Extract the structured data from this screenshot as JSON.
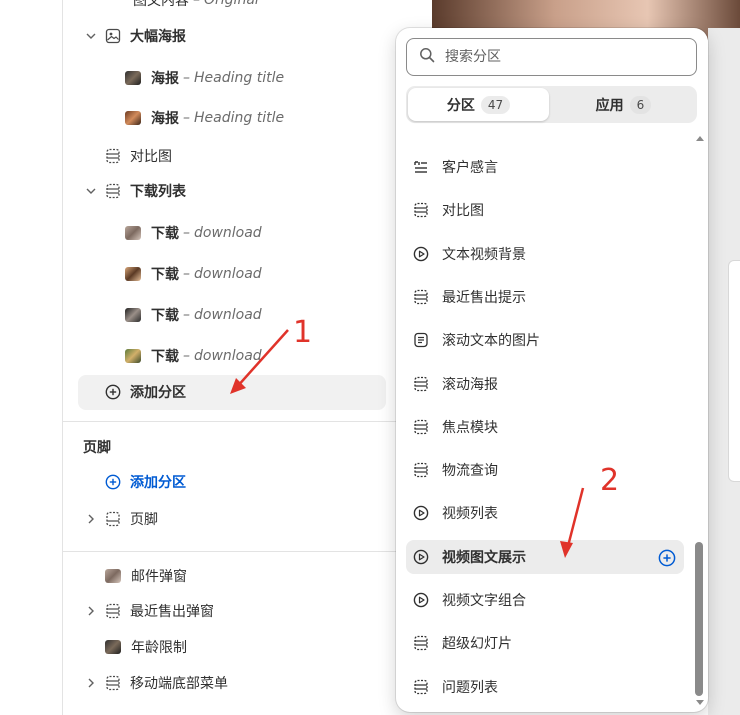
{
  "left_tree": {
    "top_cut_item": {
      "name": "图文内容",
      "subtitle": "Original"
    },
    "items": [
      {
        "label": "大幅海报",
        "icon": "image-section-icon",
        "expandable": true
      },
      {
        "label": "海报",
        "subtitle": "Heading title"
      },
      {
        "label": "海报",
        "subtitle": "Heading title"
      },
      {
        "label": "对比图",
        "icon": "section-icon"
      },
      {
        "label": "下载列表",
        "icon": "section-icon",
        "expandable": true
      },
      {
        "label": "下载",
        "subtitle": "download"
      },
      {
        "label": "下载",
        "subtitle": "download"
      },
      {
        "label": "下载",
        "subtitle": "download"
      },
      {
        "label": "下载",
        "subtitle": "download"
      }
    ],
    "add_section_label": "添加分区",
    "footer": {
      "heading": "页脚",
      "add_section_label": "添加分区",
      "item": "页脚"
    },
    "overlays": [
      "邮件弹窗",
      "最近售出弹窗",
      "年龄限制",
      "移动端底部菜单"
    ],
    "separator": "–"
  },
  "popover": {
    "search_placeholder": "搜索分区",
    "tabs": [
      {
        "label": "分区",
        "count": "47",
        "active": true
      },
      {
        "label": "应用",
        "count": "6",
        "active": false
      }
    ],
    "items": [
      {
        "label": "客户感言",
        "icon": "quote-icon"
      },
      {
        "label": "对比图",
        "icon": "section-icon"
      },
      {
        "label": "文本视频背景",
        "icon": "play-icon"
      },
      {
        "label": "最近售出提示",
        "icon": "section-icon"
      },
      {
        "label": "滚动文本的图片",
        "icon": "text-icon"
      },
      {
        "label": "滚动海报",
        "icon": "section-icon"
      },
      {
        "label": "焦点模块",
        "icon": "section-icon"
      },
      {
        "label": "物流查询",
        "icon": "section-icon"
      },
      {
        "label": "视频列表",
        "icon": "play-icon"
      },
      {
        "label": "视频图文展示",
        "icon": "play-icon",
        "selected": true
      },
      {
        "label": "视频文字组合",
        "icon": "play-icon"
      },
      {
        "label": "超级幻灯片",
        "icon": "section-icon"
      },
      {
        "label": "问题列表",
        "icon": "section-icon"
      }
    ]
  },
  "annotations": {
    "one": "1",
    "two": "2"
  },
  "colors": {
    "accent": "#005bd3",
    "annotation": "#e0332a"
  }
}
